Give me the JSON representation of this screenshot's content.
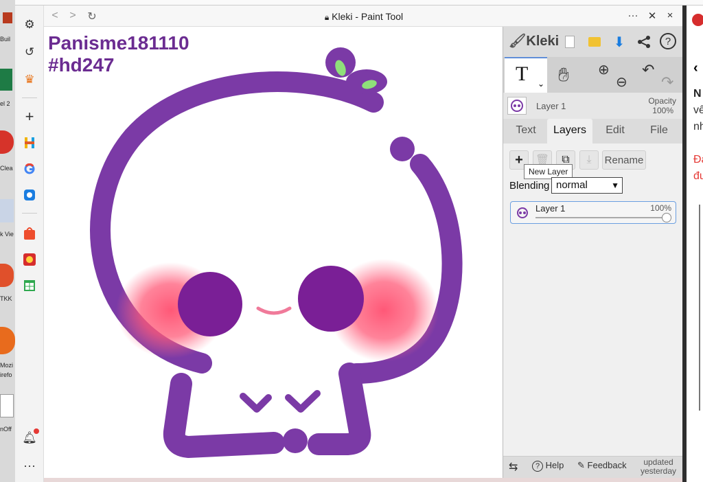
{
  "browser": {
    "title": "Kleki - Paint Tool",
    "nav": {
      "back": "<",
      "forward": ">",
      "reload": "C"
    },
    "menu_icon": "more-icon",
    "pin_icon": "pin-off-icon",
    "close": "×"
  },
  "desktop_labels": [
    "Buil",
    "el 2",
    "Clea",
    "k Vie",
    "TKK",
    "Mozi",
    "irefo",
    "nOff"
  ],
  "canvas": {
    "watermark_line1": "Panisme181110",
    "watermark_line2": "#hd247",
    "colors": {
      "body": "#7b3aa6",
      "eyes": "#7a1f96",
      "blush": "#ff4f70",
      "mouth": "#f07a9a",
      "leaf": "#8fe07a"
    }
  },
  "kleki": {
    "logo": "Kleki",
    "tools": {
      "text_tool": "T",
      "hand_icon": "hand-icon",
      "zoom_in": "⊕",
      "zoom_out": "⊖",
      "undo": "↶",
      "redo": "↷"
    },
    "current_layer": {
      "name": "Layer 1",
      "opacity_label": "Opacity",
      "opacity_value": "100%"
    },
    "tabs": [
      "Text",
      "Layers",
      "Edit",
      "File"
    ],
    "active_tab": "Layers",
    "layers_panel": {
      "tooltip": "New Layer",
      "rename": "Rename",
      "blending_label": "Blending",
      "blending_value": "normal",
      "layers": [
        {
          "name": "Layer 1",
          "opacity": "100%"
        }
      ]
    },
    "footer": {
      "help": "Help",
      "feedback": "Feedback",
      "updated_line1": "updated",
      "updated_line2": "yesterday"
    }
  },
  "rightpage": {
    "lines": [
      "N",
      "vê",
      "nh",
      "Đa",
      "đư"
    ]
  }
}
